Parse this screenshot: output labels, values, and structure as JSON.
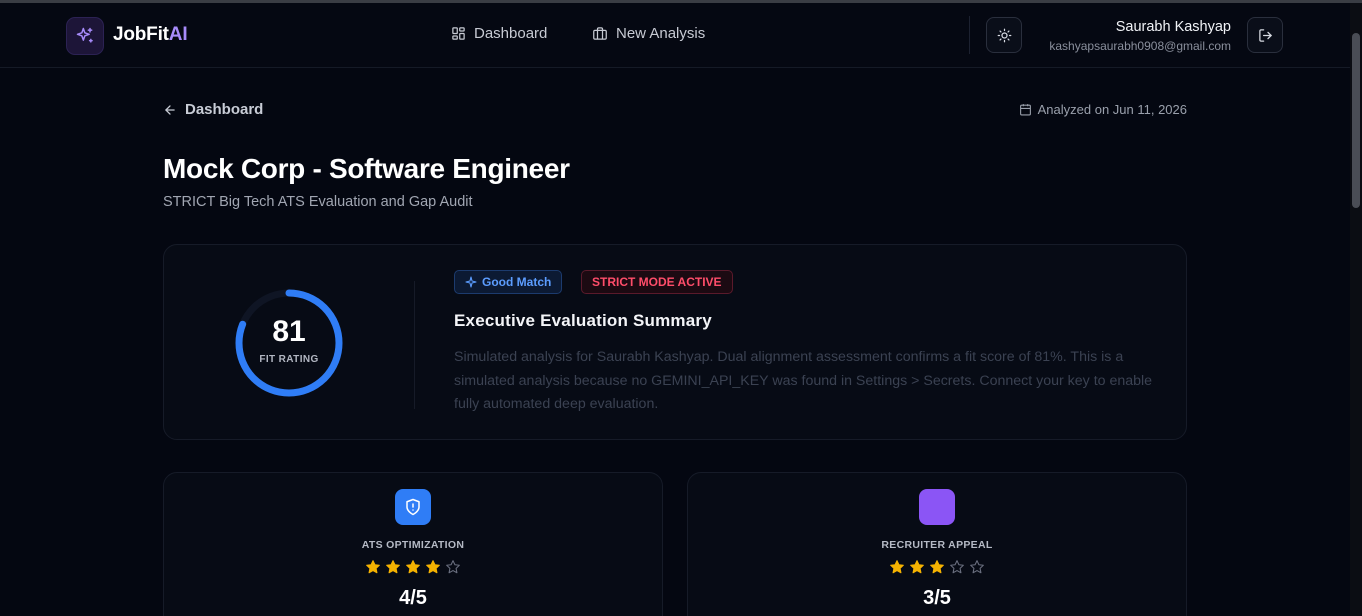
{
  "header": {
    "brand_prefix": "JobFit",
    "brand_suffix": "AI",
    "nav": [
      {
        "label": "Dashboard",
        "icon": "grid-icon"
      },
      {
        "label": "New Analysis",
        "icon": "briefcase-icon"
      }
    ],
    "user_name": "Saurabh Kashyap",
    "user_email": "kashyapsaurabh0908@gmail.com"
  },
  "breadcrumb": {
    "back_label": "Dashboard",
    "analyzed_label": "Analyzed on Jun 11, 2026"
  },
  "page": {
    "title": "Mock Corp - Software Engineer",
    "subtitle": "STRICT Big Tech ATS Evaluation and Gap Audit"
  },
  "summary": {
    "score": "81",
    "score_fraction": 0.81,
    "score_label": "FIT RATING",
    "badge_match": "Good Match",
    "badge_mode": "STRICT MODE ACTIVE",
    "heading": "Executive Evaluation Summary",
    "text": "Simulated analysis for Saurabh Kashyap. Dual alignment assessment confirms a fit score of 81%. This is a simulated analysis because no GEMINI_API_KEY was found in Settings > Secrets. Connect your key to enable fully automated deep evaluation."
  },
  "metrics": [
    {
      "label": "ATS OPTIMIZATION",
      "rating": 4,
      "max": 5,
      "score_text": "4/5",
      "icon": "shield-alert-icon",
      "color": "#2f7df6"
    },
    {
      "label": "RECRUITER APPEAL",
      "rating": 3,
      "max": 5,
      "score_text": "3/5",
      "icon": "purple-square-icon",
      "color": "#8b55f5"
    }
  ],
  "colors": {
    "accent_blue": "#2f7df6",
    "accent_purple": "#a78bfa",
    "strict_red": "#ff4d6a",
    "star": "#f5b301"
  }
}
